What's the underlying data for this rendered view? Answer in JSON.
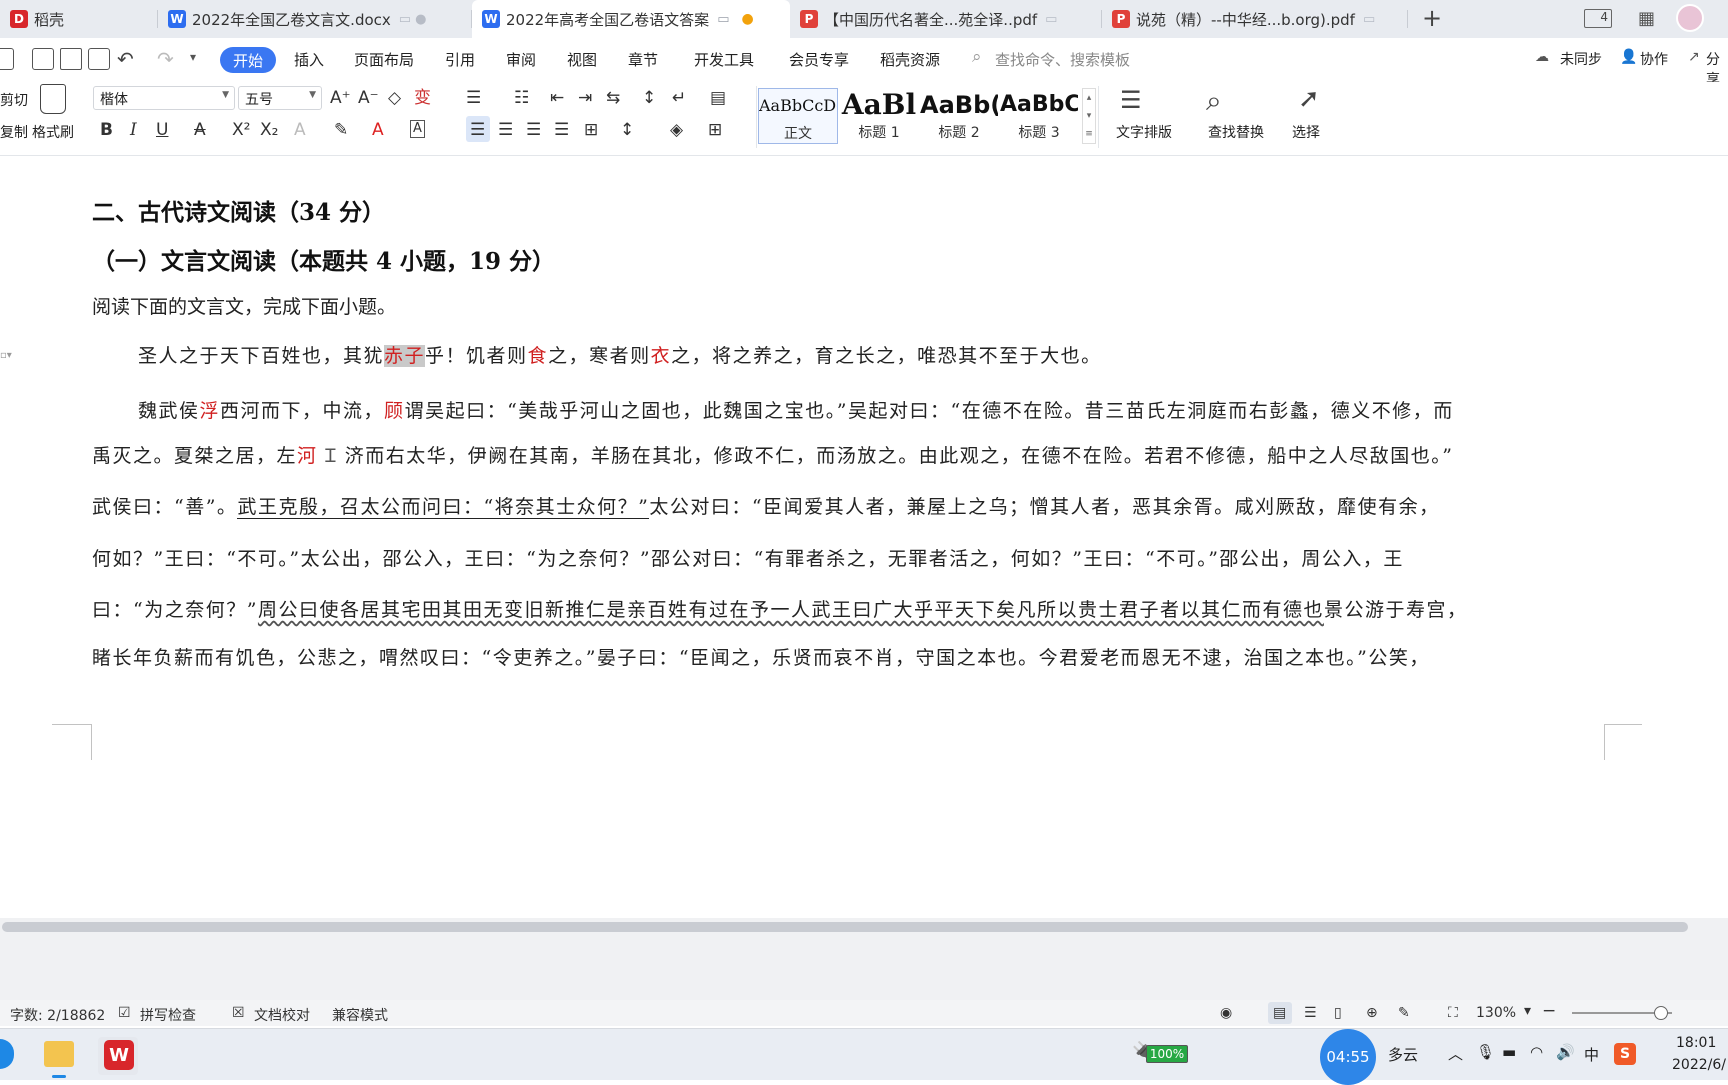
{
  "tabs": [
    {
      "label": "稻壳",
      "icon": "daoke-logo-icon"
    },
    {
      "label": "2022年全国乙卷文言文.docx",
      "icon": "word-doc-icon"
    },
    {
      "label": "2022年高考全国乙卷语文答案",
      "icon": "word-doc-icon"
    },
    {
      "label": "【中国历代名著全...苑全译..pdf",
      "icon": "pdf-icon"
    },
    {
      "label": "说苑（精）--中华经...b.org).pdf",
      "icon": "pdf-icon"
    }
  ],
  "window_badge": "4",
  "menu": {
    "items": [
      "开始",
      "插入",
      "页面布局",
      "引用",
      "审阅",
      "视图",
      "章节",
      "开发工具",
      "会员专享",
      "稻壳资源"
    ],
    "search_placeholder": "查找命令、搜索模板",
    "sync": "未同步",
    "collab": "协作",
    "share": "分享"
  },
  "ribbon": {
    "cut": "剪切",
    "copy": "复制",
    "format_painter": "格式刷",
    "font_name": "楷体",
    "font_size": "五号",
    "styles": [
      {
        "preview": "AaBbCcDd",
        "label": "正文"
      },
      {
        "preview": "AaBl",
        "label": "标题 1"
      },
      {
        "preview": "AaBb(",
        "label": "标题 2"
      },
      {
        "preview": "AaBbC",
        "label": "标题 3"
      }
    ],
    "text_layout": "文字排版",
    "find_replace": "查找替换",
    "select": "选择"
  },
  "document": {
    "section_heading": "二、古代诗文阅读（34 分）",
    "sub_heading": "（一）文言文阅读（本题共 4 小题，19 分）",
    "instruction": "阅读下面的文言文，完成下面小题。",
    "p1": {
      "a": "圣人之于天下百姓也，其犹",
      "b": "赤子",
      "c": "乎！饥者则",
      "d": "食",
      "e": "之，寒者则",
      "f": "衣",
      "g": "之，将之养之，育之长之，唯恐其不至于大也。"
    },
    "p2_l1": {
      "a": "魏武侯",
      "b": "浮",
      "c": "西河而下，中流，",
      "d": "顾",
      "e": "谓吴起曰：“美哉乎河山之固也，此魏国之宝也。”吴起对曰：“在德不在险。昔三苗氏左洞庭而右彭蠡，德义不修，而"
    },
    "p2_l2": {
      "a": "禹灭之。夏桀之居，左",
      "b": "河",
      "c": "济而右太华，伊阙在其南，羊肠在其北，修政不仁，而汤放之。由此观之，在德不在险。若君不修德，船中之人尽敌国也。”"
    },
    "p2_l3": {
      "a": "武侯曰：“善”。",
      "b": "武王克殷，召太公而问曰：“将奈其士众何？”",
      "c": "太公对曰：“臣闻爱其人者，兼屋上之乌；憎其人者，恶其余胥。咸刈厥敌，靡使有余，"
    },
    "p2_l4": "何如？”王曰：“不可。”太公出，邵公入，王曰：“为之奈何？”邵公对曰：“有罪者杀之，无罪者活之，何如？”王曰：“不可。”邵公出，周公入，王",
    "p2_l5": {
      "a": "曰：“为之奈何？”",
      "b": "周公曰使各居其宅田其田无变旧新推仁是亲百姓有过在予一人武王曰广大乎平天下矣凡所以贵士君子者以其仁而有德也",
      "c": "景公游于寿宫，"
    },
    "p2_l6": "睹长年负薪而有饥色，公悲之，喟然叹曰：“令吏养之。”晏子曰：“臣闻之，乐贤而哀不肖，守国之本也。今君爱老而恩无不逮，治国之本也。”公笑，"
  },
  "status": {
    "word_count": "字数: 2/18862",
    "spell_check": "拼写检查",
    "doc_proof": "文档校对",
    "compat_mode": "兼容模式",
    "zoom": "130%"
  },
  "ime": {
    "mode": "中",
    "punct": "°,"
  },
  "taskbar": {
    "battery": "100%",
    "timer": "04:55",
    "weather": "多云",
    "ime": "中",
    "time": "18:01",
    "date": "2022/6/"
  }
}
